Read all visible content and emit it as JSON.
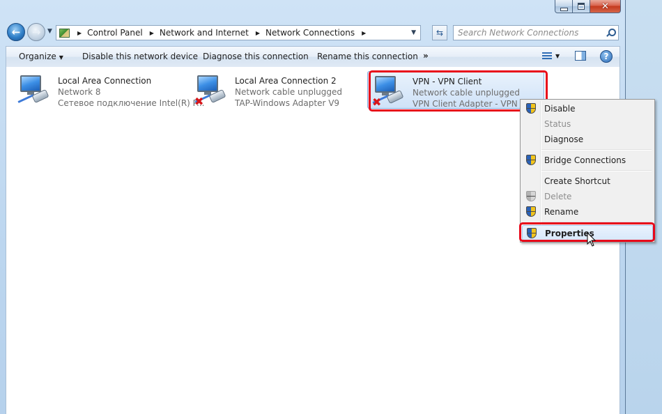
{
  "window": {
    "caption_buttons": {
      "minimize": "minimize",
      "maximize": "maximize",
      "close": "✕"
    }
  },
  "navigation": {
    "back_icon": "back-arrow-icon",
    "forward_icon": "forward-arrow-icon",
    "breadcrumb": [
      "Control Panel",
      "Network and Internet",
      "Network Connections"
    ],
    "search_placeholder": "Search Network Connections"
  },
  "toolbar": {
    "organize": "Organize",
    "disable": "Disable this network device",
    "diagnose": "Diagnose this connection",
    "rename": "Rename this connection",
    "more": "»",
    "help": "?"
  },
  "connections": [
    {
      "name": "Local Area Connection",
      "status": "Network  8",
      "adapter": "Сетевое подключение Intel(R) P...",
      "disconnected": false
    },
    {
      "name": "Local Area Connection 2",
      "status": "Network cable unplugged",
      "adapter": "TAP-Windows Adapter V9",
      "disconnected": true
    },
    {
      "name": "VPN - VPN Client",
      "status": "Network cable unplugged",
      "adapter": "VPN Client Adapter - VPN",
      "disconnected": true
    }
  ],
  "context_menu": {
    "items": [
      {
        "label": "Disable",
        "icon": "shield",
        "enabled": true
      },
      {
        "label": "Status",
        "icon": "",
        "enabled": false
      },
      {
        "label": "Diagnose",
        "icon": "",
        "enabled": true
      },
      {
        "label": "Bridge Connections",
        "icon": "shield",
        "enabled": true
      },
      {
        "label": "Create Shortcut",
        "icon": "",
        "enabled": true
      },
      {
        "label": "Delete",
        "icon": "shield",
        "enabled": false
      },
      {
        "label": "Rename",
        "icon": "shield",
        "enabled": true
      },
      {
        "label": "Properties",
        "icon": "shield",
        "enabled": true,
        "default": true
      }
    ]
  },
  "colors": {
    "highlight": "#e8081a",
    "selection": "#cfe2f8"
  }
}
